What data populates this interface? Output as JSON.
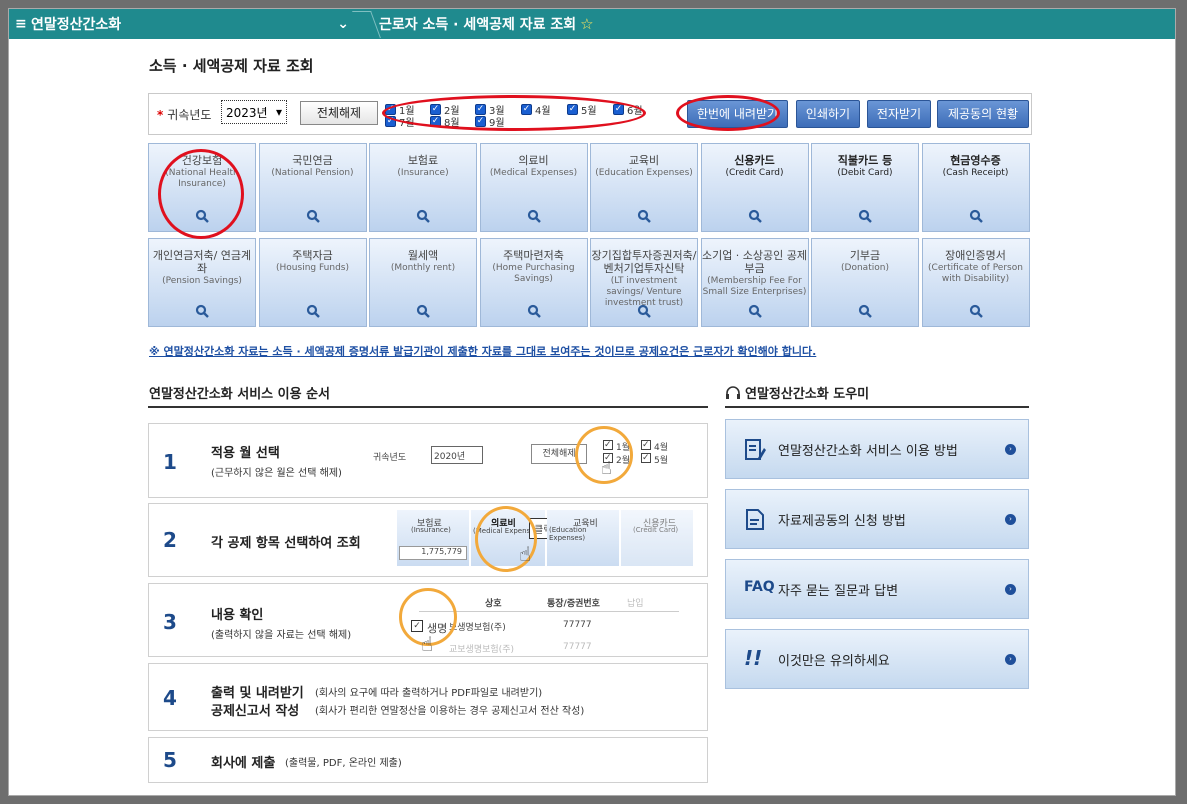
{
  "topbar": {
    "menu_icon": "≡",
    "app_name": "연말정산간소화",
    "chevron": "⌄",
    "page_name": "근로자 소득 · 세액공제 자료 조회",
    "star": "☆"
  },
  "page_title": "소득 · 세액공제 자료 조회",
  "filter": {
    "year_label": "귀속년도",
    "required_mark": "*",
    "year_value": "2023년",
    "deselect_all": "전체해제",
    "months": [
      "1월",
      "2월",
      "3월",
      "4월",
      "5월",
      "6월",
      "7월",
      "8월",
      "9월"
    ],
    "download_all": "한번에 내려받기",
    "print": "인쇄하기",
    "e_document": "전자받기",
    "provision_status": "제공동의 현황"
  },
  "categories": [
    {
      "ko": "건강보험",
      "en": "(National Health Insurance)"
    },
    {
      "ko": "국민연금",
      "en": "(National Pension)"
    },
    {
      "ko": "보험료",
      "en": "(Insurance)"
    },
    {
      "ko": "의료비",
      "en": "(Medical Expenses)"
    },
    {
      "ko": "교육비",
      "en": "(Education Expenses)"
    },
    {
      "ko": "신용카드",
      "en": "(Credit Card)"
    },
    {
      "ko": "직불카드 등",
      "en": "(Debit Card)"
    },
    {
      "ko": "현금영수증",
      "en": "(Cash Receipt)"
    },
    {
      "ko": "개인연금저축/ 연금계좌",
      "en": "(Pension Savings)"
    },
    {
      "ko": "주택자금",
      "en": "(Housing Funds)"
    },
    {
      "ko": "월세액",
      "en": "(Monthly rent)"
    },
    {
      "ko": "주택마련저축",
      "en": "(Home Purchasing Savings)"
    },
    {
      "ko": "장기집합투자증권저축/ 벤처기업투자신탁",
      "en": "(LT investment savings/ Venture investment trust)"
    },
    {
      "ko": "소기업 · 소상공인 공제부금",
      "en": "(Membership Fee For Small Size Enterprises)"
    },
    {
      "ko": "기부금",
      "en": "(Donation)"
    },
    {
      "ko": "장애인증명서",
      "en": "(Certificate of Person with Disability)"
    }
  ],
  "notice": "※ 연말정산간소화 자료는 소득 · 세액공제 증명서류 발급기관이 제출한 자료를 그대로 보여주는 것이므로 공제요건은 근로자가 확인해야 합니다.",
  "steps_title": "연말정산간소화 서비스 이용 순서",
  "steps": [
    {
      "num": "1",
      "title": "적용 월 선택",
      "desc": "(근무하지 않은 월은 선택 해제)"
    },
    {
      "num": "2",
      "title": "각 공제 항목 선택하여 조회",
      "desc": ""
    },
    {
      "num": "3",
      "title": "내용 확인",
      "desc": "(출력하지 않을 자료는 선택 해제)"
    },
    {
      "num": "4",
      "title": "출력 및 내려받기",
      "title2": "공제신고서 작성",
      "desc": "(회사의 요구에 따라 출력하거나 PDF파일로 내려받기)",
      "desc2": "(회사가 편리한 연말정산을 이용하는 경우 공제신고서 전산 작성)"
    },
    {
      "num": "5",
      "title": "회사에 제출",
      "desc": "(출력물, PDF, 온라인 제출)"
    }
  ],
  "step_illus": {
    "s1_year_label": "귀속년도",
    "s1_year": "2020년",
    "s1_btn": "전체해제",
    "s1_m1": "1월",
    "s1_m2": "2월",
    "s1_m4": "4월",
    "s1_m5": "5월",
    "s2_c1": "보험료",
    "s2_c1en": "(Insurance)",
    "s2_val": "1,775,779",
    "s2_c2": "의료비",
    "s2_c2en": "(Medical Expenses)",
    "s2_tip": "클릭!",
    "s2_c3": "교육비",
    "s2_c3en": "(Education Expenses)",
    "s2_c4": "신용카드",
    "s2_c4en": "(Credit Card)",
    "s3_h1": "상호",
    "s3_h2": "통장/증권번호",
    "s3_h3": "납입",
    "s3_r1": "보생명보험(주)",
    "s3_r1v": "77777",
    "s3_r2": "교보생명보험(주)",
    "s3_r2v": "77777",
    "s3_name": "생명"
  },
  "helper_title": "연말정산간소화 도우미",
  "helpers": [
    {
      "label": "연말정산간소화 서비스 이용 방법",
      "icon": "document-pen-icon"
    },
    {
      "label": "자료제공동의 신청 방법",
      "icon": "document-icon"
    },
    {
      "label": "자주 묻는 질문과 답변",
      "icon": "faq-icon",
      "prefix": "FAQ"
    },
    {
      "label": "이것만은 유의하세요",
      "icon": "exclamation-icon"
    }
  ],
  "colors": {
    "topbar": "#1f8a8e",
    "accent_blue": "#1d4a8a",
    "highlight_red": "#e0101e",
    "highlight_orange": "#f2a93b"
  }
}
